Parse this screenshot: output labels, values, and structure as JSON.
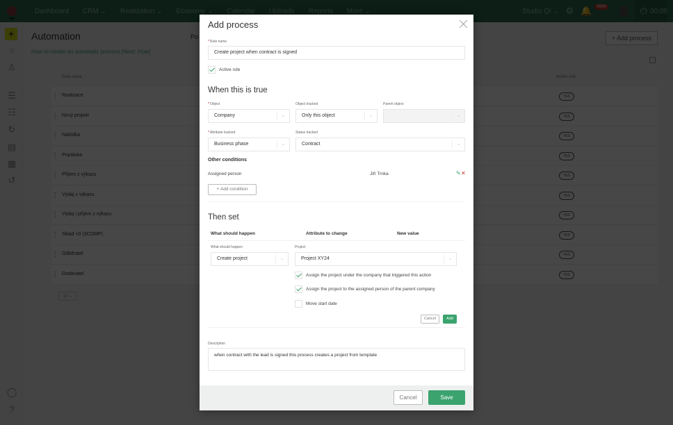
{
  "topbar": {
    "nav": [
      "Dashboard",
      "CRM ⌄",
      "Realization ⌄",
      "Economy ⌄",
      "Calendar",
      "Uploads",
      "Reports",
      "More ⌄"
    ],
    "studio": "Studio Ql ⌄",
    "notification_badge": "9999",
    "timer": "00:00"
  },
  "page": {
    "title": "Automation",
    "help_link": "How to create an automatic process [Next: How]",
    "process_tab": "Po",
    "add_process_button": "+ Add process",
    "table_headers": {
      "name": "Rule name",
      "active": "Active rule"
    },
    "rows": [
      {
        "name": "Realizace",
        "active": "YES"
      },
      {
        "name": "Nový projekt",
        "active": "YES"
      },
      {
        "name": "Nabídka",
        "active": "YES"
      },
      {
        "name": "Poptávka",
        "active": "YES"
      },
      {
        "name": "Příjem z výkazu",
        "active": "YES"
      },
      {
        "name": "Výdaj z výkazu",
        "active": "YES"
      },
      {
        "name": "Výdaj i příjem z výkazu",
        "active": "YES"
      },
      {
        "name": "Sklad <0 (3COMP)",
        "active": "YES"
      },
      {
        "name": "Odběratel",
        "active": "YES"
      },
      {
        "name": "Dodavatel",
        "active": "YES"
      }
    ],
    "page_size": "10 ⌄"
  },
  "modal": {
    "title": "Add process",
    "rule_name_label": "Rule name",
    "rule_name_value": "Create project when contract is signed",
    "active_rule_label": "Active rule",
    "active_rule_checked": true,
    "when_heading": "When this is true",
    "object_label": "Object",
    "object_value": "Company",
    "object_tracked_label": "Object tracked",
    "object_tracked_value": "Only this object",
    "parent_object_label": "Parent object",
    "parent_object_value": "",
    "attribute_tracked_label": "Attribute tracked",
    "attribute_tracked_value": "Business phase",
    "status_tracked_label": "Status tracked",
    "status_tracked_value": "Contract",
    "other_conditions_heading": "Other conditions",
    "condition": {
      "field": "Assigned person",
      "value": "Jiří Trnka"
    },
    "add_condition_button": "+ Add condition",
    "then_heading": "Then set",
    "then_columns": [
      "What should happen",
      "Attribute to change",
      "New value"
    ],
    "what_label": "What should happen",
    "what_value": "Create project",
    "project_label": "Project",
    "project_value": "Project XY24",
    "options": [
      {
        "label": "Assign the project under the company that triggered this action",
        "checked": true
      },
      {
        "label": "Assign the project to the assigned person of the parent company",
        "checked": true
      },
      {
        "label": "Move start date",
        "checked": false
      }
    ],
    "inner_cancel": "Cancel",
    "inner_add": "Add",
    "description_label": "Description",
    "description_value": "when contract with the lead is signed this process creates a project from template",
    "cancel_button": "Cancel",
    "save_button": "Save"
  },
  "colors": {
    "brand_green": "#3aa36e",
    "topbar": "#2e6b4f",
    "danger": "#c0392b"
  }
}
